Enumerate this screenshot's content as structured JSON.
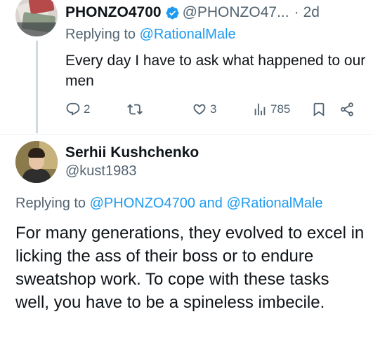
{
  "reply_tweet": {
    "author_name": "PHONZO4700",
    "handle": "@PHONZO47...",
    "dot": "·",
    "time": "2d",
    "replying_prefix": "Replying to",
    "replying_to": "@RationalMale",
    "text": "Every day I have to ask what happened to our men",
    "avatar_icon": "profile-photo",
    "verified_icon": "verified-badge-icon",
    "actions": {
      "replies": "2",
      "retweets": "",
      "likes": "3",
      "views": "785"
    }
  },
  "main_tweet": {
    "author_name": "Serhii Kushchenko",
    "handle": "@kust1983",
    "replying_prefix": "Replying to",
    "replying_to_1": "@PHONZO4700",
    "replying_and": "and",
    "replying_to_2": "@RationalMale",
    "text": "For many generations, they evolved to excel in licking the ass of their boss or to endure sweatshop work. To cope with these tasks well, you have to be a spineless imbecile.",
    "avatar_icon": "profile-photo"
  },
  "colors": {
    "accent": "#1d9bf0",
    "text_primary": "#0f1419",
    "text_secondary": "#536471",
    "thread_line": "#cfd9de"
  }
}
